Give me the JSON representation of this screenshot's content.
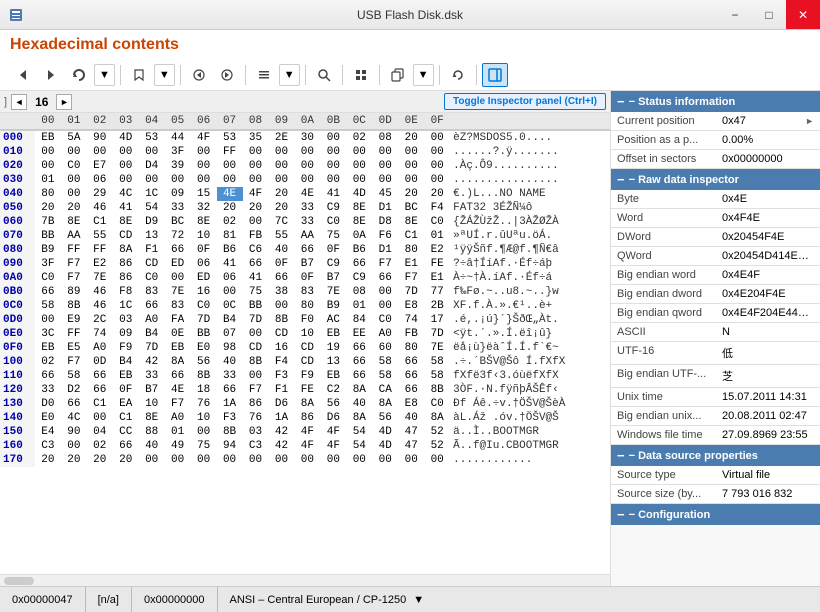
{
  "titlebar": {
    "title": "USB Flash Disk.dsk",
    "icon": "disk-icon",
    "min_label": "−",
    "max_label": "□",
    "close_label": "✕"
  },
  "header": {
    "title": "Hexadecimal contents"
  },
  "toolbar": {
    "buttons": [
      {
        "name": "back-btn",
        "icon": "◄",
        "label": "Back"
      },
      {
        "name": "forward-btn",
        "icon": "►",
        "label": "Forward"
      },
      {
        "name": "reload-btn",
        "icon": "⟳",
        "label": "Reload"
      },
      {
        "name": "bookmark-btn",
        "icon": "🔖",
        "label": "Bookmark"
      },
      {
        "name": "prev-btn",
        "icon": "◄",
        "label": "Previous"
      },
      {
        "name": "next-btn",
        "icon": "►",
        "label": "Next"
      },
      {
        "name": "list-btn",
        "icon": "☰",
        "label": "List"
      },
      {
        "name": "search-btn",
        "icon": "🔍",
        "label": "Search"
      },
      {
        "name": "grid-btn",
        "icon": "⊞",
        "label": "Grid"
      },
      {
        "name": "copy-btn",
        "icon": "⎘",
        "label": "Copy"
      },
      {
        "name": "refresh-btn",
        "icon": "↺",
        "label": "Refresh"
      },
      {
        "name": "inspector-btn",
        "icon": "▣",
        "label": "Inspector",
        "active": true
      }
    ]
  },
  "hex_nav": {
    "prev_label": "◄",
    "page": "16",
    "next_label": "►",
    "toggle_label": "Toggle Inspector panel (Ctrl+I)"
  },
  "hex_columns": [
    "",
    "00",
    "01",
    "02",
    "03",
    "04",
    "05",
    "06",
    "07",
    "08",
    "09",
    "0A",
    "0B",
    "0C",
    "0D",
    "0E",
    "0F",
    ""
  ],
  "hex_rows": [
    {
      "addr": "000",
      "bytes": [
        "EB",
        "5A",
        "90",
        "4D",
        "53",
        "44",
        "4F",
        "53",
        "35",
        "2E",
        "30",
        "00",
        "02",
        "08",
        "20",
        "00"
      ],
      "text": "èZ?MSDOS5.0...."
    },
    {
      "addr": "010",
      "bytes": [
        "00",
        "00",
        "00",
        "00",
        "00",
        "3F",
        "00",
        "FF",
        "00",
        "00",
        "00",
        "00",
        "00",
        "00",
        "00",
        "00"
      ],
      "text": "......?.ÿ......."
    },
    {
      "addr": "020",
      "bytes": [
        "00",
        "C0",
        "E7",
        "00",
        "D4",
        "39",
        "00",
        "00",
        "00",
        "00",
        "00",
        "00",
        "00",
        "00",
        "00",
        "00"
      ],
      "text": ".Àç.Ô9.........."
    },
    {
      "addr": "030",
      "bytes": [
        "01",
        "00",
        "06",
        "00",
        "00",
        "00",
        "00",
        "00",
        "00",
        "00",
        "00",
        "00",
        "00",
        "00",
        "00",
        "00"
      ],
      "text": "................"
    },
    {
      "addr": "040",
      "bytes": [
        "80",
        "00",
        "29",
        "4C",
        "1C",
        "09",
        "15",
        "4E",
        "4F",
        "20",
        "4E",
        "41",
        "4D",
        "45",
        "20",
        "20"
      ],
      "text": "€.)L...NO NAME  ",
      "highlight": 7
    },
    {
      "addr": "050",
      "bytes": [
        "20",
        "20",
        "46",
        "41",
        "54",
        "33",
        "32",
        "20",
        "20",
        "20",
        "33",
        "C9",
        "8E",
        "D1",
        "BC",
        "F4"
      ],
      "text": "  FAT32   3ÉŽÑ¼ô"
    },
    {
      "addr": "060",
      "bytes": [
        "7B",
        "8E",
        "C1",
        "8E",
        "D9",
        "BC",
        "8E",
        "02",
        "00",
        "7C",
        "33",
        "C0",
        "8E",
        "D8",
        "8E",
        "C0"
      ],
      "text": "{ŽÁŽÙžŽ..|3ÀŽØŽÀ"
    },
    {
      "addr": "070",
      "bytes": [
        "BB",
        "AA",
        "55",
        "CD",
        "13",
        "72",
        "10",
        "81",
        "FB",
        "55",
        "AA",
        "75",
        "0A",
        "F6",
        "C1",
        "01"
      ],
      "text": "»ªUÍ.r.ûUªu.öÁ."
    },
    {
      "addr": "080",
      "bytes": [
        "B9",
        "FF",
        "FF",
        "8A",
        "F1",
        "66",
        "0F",
        "B6",
        "C6",
        "40",
        "66",
        "0F",
        "B6",
        "D1",
        "80",
        "E2"
      ],
      "text": "¹ÿÿŠñf.¶Æ@f.¶Ñ€â"
    },
    {
      "addr": "090",
      "bytes": [
        "3F",
        "F7",
        "E2",
        "86",
        "CD",
        "ED",
        "06",
        "41",
        "66",
        "0F",
        "B7",
        "C9",
        "66",
        "F7",
        "E1",
        "FE"
      ],
      "text": "?÷â†ÍíAf.·Éf÷áþ"
    },
    {
      "addr": "0A0",
      "bytes": [
        "C0",
        "F7",
        "7E",
        "86",
        "C0",
        "00",
        "ED",
        "06",
        "41",
        "66",
        "0F",
        "B7",
        "C9",
        "66",
        "F7",
        "E1"
      ],
      "text": "À÷~†À.íAf.·Éf÷á"
    },
    {
      "addr": "0B0",
      "bytes": [
        "66",
        "89",
        "46",
        "F8",
        "83",
        "7E",
        "16",
        "00",
        "75",
        "38",
        "83",
        "7E",
        "08",
        "00",
        "7D",
        "77"
      ],
      "text": "f‰Fø.~..u8.~..}w"
    },
    {
      "addr": "0C0",
      "bytes": [
        "58",
        "8B",
        "46",
        "1C",
        "66",
        "83",
        "C0",
        "0C",
        "BB",
        "00",
        "80",
        "B9",
        "01",
        "00",
        "E8",
        "2B"
      ],
      "text": "XF.f.À.».€¹..è+"
    },
    {
      "addr": "0D0",
      "bytes": [
        "00",
        "E9",
        "2C",
        "03",
        "A0",
        "FA",
        "7D",
        "B4",
        "7D",
        "8B",
        "F0",
        "AC",
        "84",
        "C0",
        "74",
        "17"
      ],
      "text": ".é,.¡ú}´}ŠðŒ„Àt."
    },
    {
      "addr": "0E0",
      "bytes": [
        "3C",
        "FF",
        "74",
        "09",
        "B4",
        "0E",
        "BB",
        "07",
        "00",
        "CD",
        "10",
        "EB",
        "EE",
        "A0",
        "FB",
        "7D"
      ],
      "text": "<ÿt.´.».Í.ëî¡û}"
    },
    {
      "addr": "0F0",
      "bytes": [
        "EB",
        "E5",
        "A0",
        "F9",
        "7D",
        "EB",
        "E0",
        "98",
        "CD",
        "16",
        "CD",
        "19",
        "66",
        "60",
        "80",
        "7E"
      ],
      "text": "ëå¡ù}ëàˆÍ.Í.f`€~"
    },
    {
      "addr": "100",
      "bytes": [
        "02",
        "F7",
        "0D",
        "B4",
        "42",
        "8A",
        "56",
        "40",
        "8B",
        "F4",
        "CD",
        "13",
        "66",
        "58",
        "66",
        "58"
      ],
      "text": ".÷.´BŠV@Šô Í.fXfX"
    },
    {
      "addr": "110",
      "bytes": [
        "66",
        "58",
        "66",
        "EB",
        "33",
        "66",
        "8B",
        "33",
        "00",
        "F3",
        "F9",
        "EB",
        "66",
        "58",
        "66",
        "58"
      ],
      "text": "fXfë3f‹3.óùëfXfX"
    },
    {
      "addr": "120",
      "bytes": [
        "33",
        "D2",
        "66",
        "0F",
        "B7",
        "4E",
        "18",
        "66",
        "F7",
        "F1",
        "FE",
        "C2",
        "8A",
        "CA",
        "66",
        "8B"
      ],
      "text": "3ÒF.·N.fÿñþÂŠÊf‹"
    },
    {
      "addr": "130",
      "bytes": [
        "D0",
        "66",
        "C1",
        "EA",
        "10",
        "F7",
        "76",
        "1A",
        "86",
        "D6",
        "8A",
        "56",
        "40",
        "8A",
        "E8",
        "C0"
      ],
      "text": "Ðf Áê.÷v.†ÖŠV@ŠèÀ"
    },
    {
      "addr": "140",
      "bytes": [
        "E0",
        "4C",
        "00",
        "C1",
        "8E",
        "A0",
        "10",
        "F3",
        "76",
        "1A",
        "86",
        "D6",
        "8A",
        "56",
        "40",
        "8A"
      ],
      "text": "àL.Áž .óv.†ÖŠV@Š"
    },
    {
      "addr": "150",
      "bytes": [
        "E4",
        "90",
        "04",
        "CC",
        "88",
        "01",
        "00",
        "8B",
        "03",
        "42",
        "4F",
        "4F",
        "54",
        "4D",
        "47",
        "52"
      ],
      "text": "ä..Ì..BOOTMGR"
    },
    {
      "addr": "160",
      "bytes": [
        "C3",
        "00",
        "02",
        "66",
        "40",
        "49",
        "75",
        "94",
        "C3",
        "42",
        "4F",
        "4F",
        "54",
        "4D",
        "47",
        "52"
      ],
      "text": "Ã..f@Iu.CBOOTMGR"
    },
    {
      "addr": "170",
      "bytes": [
        "20",
        "20",
        "20",
        "20",
        "00",
        "00",
        "00",
        "00",
        "00",
        "00",
        "00",
        "00",
        "00",
        "00",
        "00",
        "00"
      ],
      "text": "    ............"
    }
  ],
  "inspector": {
    "sections": [
      {
        "name": "Status information",
        "label": "Status information",
        "rows": [
          {
            "label": "Current position",
            "value": "0x47",
            "has_arrow": true
          },
          {
            "label": "Position as a p...",
            "value": "0.00%"
          },
          {
            "label": "Offset in sectors",
            "value": "0x00000000"
          }
        ]
      },
      {
        "name": "Raw data inspector",
        "label": "Raw data inspector",
        "rows": [
          {
            "label": "Byte",
            "value": "0x4E"
          },
          {
            "label": "Word",
            "value": "0x4F4E"
          },
          {
            "label": "DWord",
            "value": "0x20454F4E"
          },
          {
            "label": "QWord",
            "value": "0x20454D414E204F"
          },
          {
            "label": "Big endian word",
            "value": "0x4E4F"
          },
          {
            "label": "Big endian dword",
            "value": "0x4E204F4E"
          },
          {
            "label": "Big endian qword",
            "value": "0x4E4F204E4414D4"
          },
          {
            "label": "ASCII",
            "value": "N"
          },
          {
            "label": "UTF-16",
            "value": "低"
          },
          {
            "label": "Big endian UTF-...",
            "value": "芝"
          },
          {
            "label": "Unix time",
            "value": "15.07.2011 14:31"
          },
          {
            "label": "Big endian unix...",
            "value": "20.08.2011 02:47"
          },
          {
            "label": "Windows file time",
            "value": "27.09.8969 23:55"
          }
        ]
      },
      {
        "name": "Data source properties",
        "label": "Data source properties",
        "rows": [
          {
            "label": "Source type",
            "value": "Virtual file"
          },
          {
            "label": "Source size (by...",
            "value": "7 793 016 832"
          }
        ]
      },
      {
        "name": "Configuration",
        "label": "Configuration",
        "rows": []
      }
    ]
  },
  "statusbar": {
    "position": "0x00000047",
    "selection": "[n/a]",
    "offset": "0x00000000",
    "encoding": "ANSI – Central European / CP-1250"
  }
}
